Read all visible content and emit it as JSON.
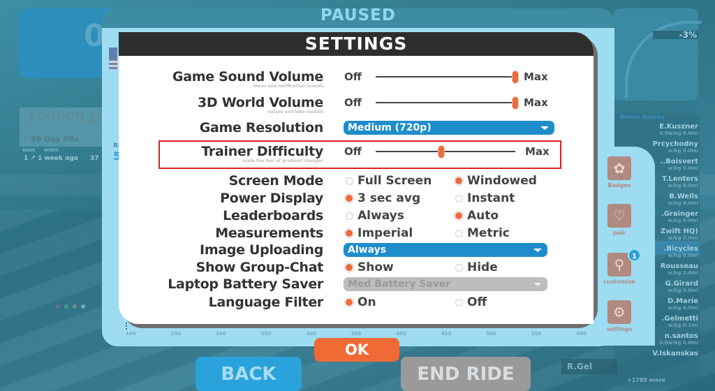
{
  "background": {
    "hud_power_partial": "0",
    "segment": {
      "title": "LONDON LO",
      "percent": "0.0%",
      "prs_label": "30 Day PRs",
      "col_rank": "RANK",
      "col_when": "WHEN",
      "row_rank": "1",
      "row_when": "1 week ago",
      "row_time_partial": "37"
    },
    "frame_left_small": "RI",
    "frame_left_big": "5",
    "minimap_grade": "-3%",
    "riders_title": "Riders Nearby",
    "riders": [
      {
        "name": "E.Kuszner",
        "sub": "0.0w/kg   0.0mi"
      },
      {
        "name": "Prcychodny",
        "sub": "w/kg   0.0mi"
      },
      {
        "name": "..Boisvert",
        "sub": "w/kg   0.0mi"
      },
      {
        "name": "T.Lenters",
        "sub": "w/kg   0.0mi"
      },
      {
        "name": "B.Wells",
        "sub": "w/kg   0.0mi"
      },
      {
        "name": ".Grainger",
        "sub": "w/kg   0.0mi"
      },
      {
        "name": "Zwift HQ)",
        "sub": "w/kg   0.0mi"
      },
      {
        "name": ".Bicycles",
        "sub": "w/kg   0.0mi"
      },
      {
        "name": "Rousseau",
        "sub": "w/kg   0.0mi"
      },
      {
        "name": "G.Girard",
        "sub": "w/kg   0.0mi"
      },
      {
        "name": "D.Marie",
        "sub": "w/kg   0.0mi"
      },
      {
        "name": ".Gelmetti",
        "sub": "w/kg   0.1mi"
      },
      {
        "name": "n.santos",
        "sub": "0.0w/kg   0.0mi"
      },
      {
        "name": "V.Iskanskas",
        "sub": ""
      }
    ],
    "riders_more": "+1785 more",
    "bottom_rider_tag": "R.Gel",
    "dot_colors": [
      "#6f6f8a",
      "#3fa07a",
      "#7a8a8f",
      "#6fb0c4"
    ]
  },
  "paused": {
    "title": "PAUSED"
  },
  "side_menu": {
    "items": [
      {
        "label": "Badges",
        "icon": "ribbon-icon"
      },
      {
        "label": "pair",
        "icon": "sensors-icon"
      },
      {
        "label": "customize",
        "icon": "jersey-bike-icon",
        "badge": "1"
      },
      {
        "label": "settings",
        "icon": "gears-icon"
      }
    ]
  },
  "axis_ticks": [
    "100",
    "150",
    "200",
    "250",
    "300",
    "350",
    "400",
    "450",
    "500",
    "550",
    "600"
  ],
  "settings": {
    "title": "SETTINGS",
    "slider_off": "Off",
    "slider_max": "Max",
    "game_sound_volume": {
      "label": "Game Sound Volume",
      "sublabel": "menu and notification sounds",
      "value_fraction": 1.0
    },
    "world_volume": {
      "label": "3D World Volume",
      "sublabel": "nature and bike sounds",
      "value_fraction": 1.0
    },
    "game_resolution": {
      "label": "Game Resolution",
      "value": "Medium (720p)"
    },
    "trainer_difficulty": {
      "label": "Trainer Difficulty",
      "sublabel": "scale the feel of gradient changes",
      "value_fraction": 0.47
    },
    "screen_mode": {
      "label": "Screen Mode",
      "options": [
        "Full Screen",
        "Windowed"
      ],
      "selected": "Windowed"
    },
    "power_display": {
      "label": "Power Display",
      "options": [
        "3 sec avg",
        "Instant"
      ],
      "selected": "3 sec avg"
    },
    "leaderboards": {
      "label": "Leaderboards",
      "options": [
        "Always",
        "Auto"
      ],
      "selected": "Auto"
    },
    "measurements": {
      "label": "Measurements",
      "options": [
        "Imperial",
        "Metric"
      ],
      "selected": "Imperial"
    },
    "image_uploading": {
      "label": "Image Uploading",
      "value": "Always"
    },
    "group_chat": {
      "label": "Show Group-Chat",
      "options": [
        "Show",
        "Hide"
      ],
      "selected": "Show"
    },
    "battery_saver": {
      "label": "Laptop Battery Saver",
      "value": "Med Battery Saver",
      "disabled": true
    },
    "language_filter": {
      "label": "Language Filter",
      "options": [
        "On",
        "Off"
      ],
      "selected": "On"
    }
  },
  "buttons": {
    "ok": "OK",
    "back": "BACK",
    "end_ride": "END RIDE"
  },
  "colors": {
    "accent_orange": "#ef6b3c",
    "dropdown_blue": "#1e8dcb",
    "highlight_red": "#e02020",
    "back_blue": "#2aa3dc",
    "end_ride_gray": "#9a9a9a"
  }
}
